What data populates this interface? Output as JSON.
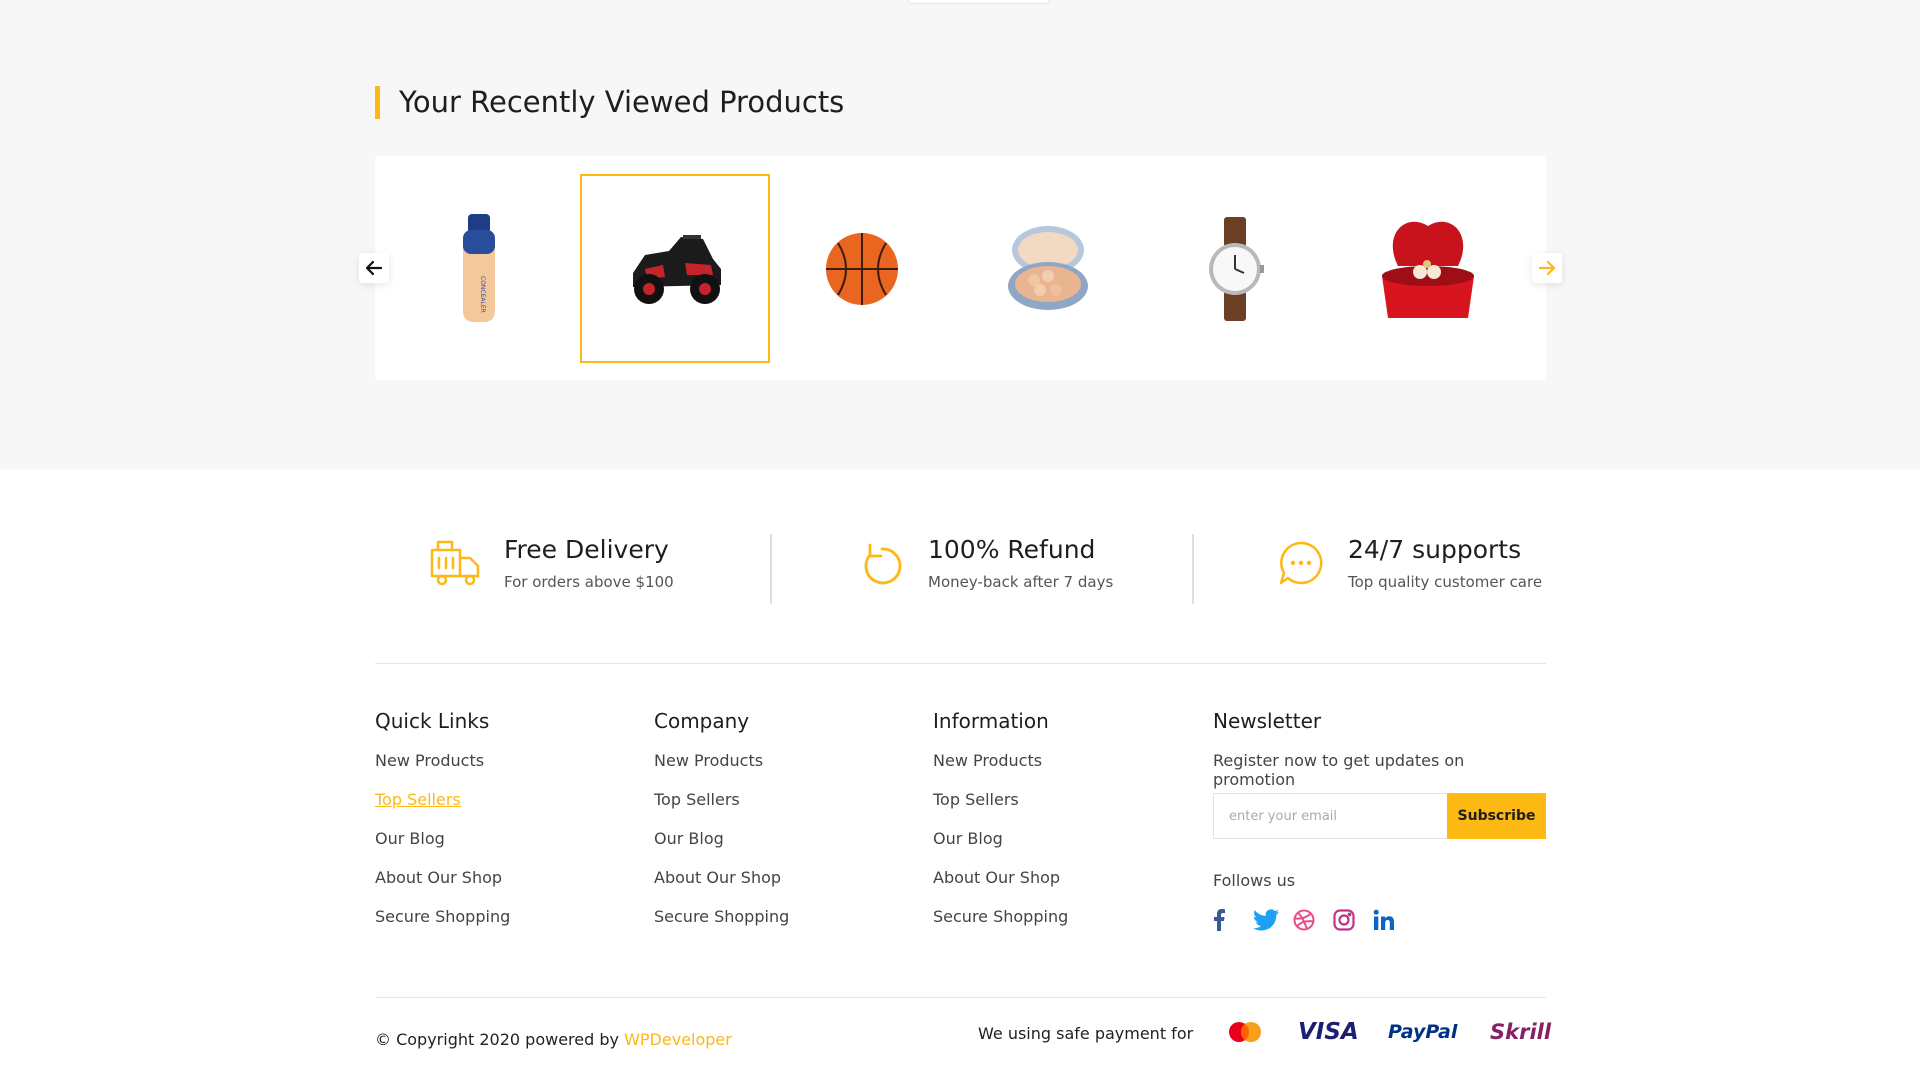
{
  "recent": {
    "title": "Your Recently Viewed Products",
    "products": [
      {
        "name": "concealer-bottle-image"
      },
      {
        "name": "toy-jeep-image"
      },
      {
        "name": "basketball-image"
      },
      {
        "name": "powder-compact-image"
      },
      {
        "name": "wrist-watch-image"
      },
      {
        "name": "ring-box-image"
      }
    ],
    "bottle_label": "CONCEALER"
  },
  "features": [
    {
      "title": "Free Delivery",
      "subtitle": "For orders above $100",
      "icon": "delivery-truck-icon"
    },
    {
      "title": "100% Refund",
      "subtitle": "Money-back after 7 days",
      "icon": "refund-icon"
    },
    {
      "title": "24/7 supports",
      "subtitle": "Top quality customer care",
      "icon": "chat-support-icon"
    }
  ],
  "columns": [
    {
      "title": "Quick Links",
      "links": [
        "New Products",
        "Top Sellers",
        "Our Blog",
        "About Our Shop",
        "Secure Shopping"
      ]
    },
    {
      "title": "Company",
      "links": [
        "New Products",
        "Top Sellers",
        "Our Blog",
        "About Our Shop",
        "Secure Shopping"
      ]
    },
    {
      "title": "Information",
      "links": [
        "New Products",
        "Top Sellers",
        "Our Blog",
        "About Our Shop",
        "Secure Shopping"
      ]
    }
  ],
  "newsletter": {
    "title": "Newsletter",
    "text": "Register now to get updates on promotion",
    "placeholder": "enter your email",
    "button": "Subscribe",
    "follow": "Follows us",
    "social": [
      "facebook-icon",
      "twitter-icon",
      "dribbble-icon",
      "instagram-icon",
      "linkedin-icon"
    ]
  },
  "bottom": {
    "copyright": "© Copyright 2020 powered by ",
    "brand": "WPDeveloper",
    "payment_text": "We using safe payment for",
    "payments": [
      "VISA",
      "PayPal",
      "Skrill"
    ]
  },
  "colors": {
    "accent": "#fdb813",
    "facebook": "#3b5998",
    "twitter": "#1da1f2",
    "dribbble": "#ea4c89",
    "instagram": "#c13584",
    "linkedin": "#0a66c2"
  }
}
